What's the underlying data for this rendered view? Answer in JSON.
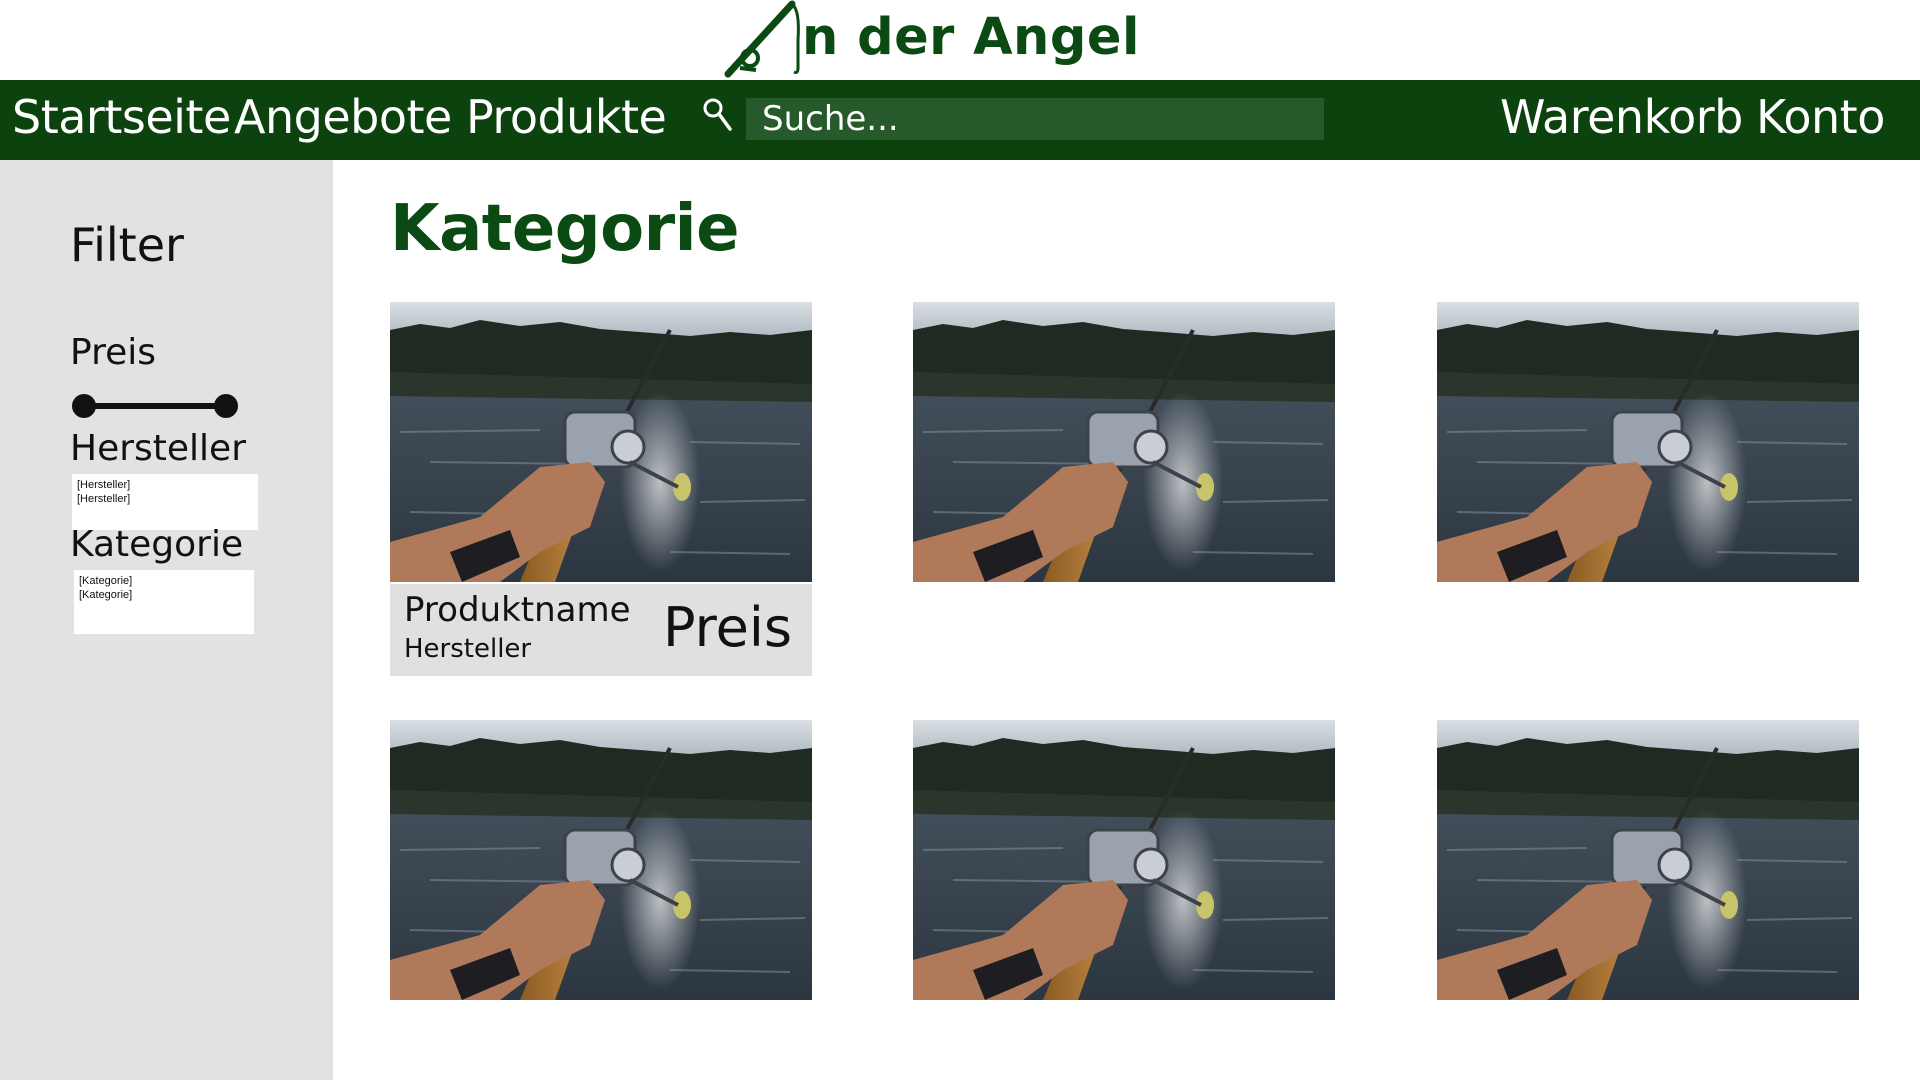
{
  "logo": {
    "text": "n der Angel",
    "icon": "fishing-rod-logo"
  },
  "nav": {
    "left_items": [
      "Startseite",
      "Angebote",
      "Produkte"
    ],
    "search_placeholder": "Suche...",
    "right_items": [
      "Warenkorb",
      "Konto"
    ]
  },
  "sidebar": {
    "title": "Filter",
    "price_label": "Preis",
    "manufacturer_label": "Hersteller",
    "manufacturer_options": [
      "[Hersteller]",
      "[Hersteller]"
    ],
    "category_label": "Kategorie",
    "category_options": [
      "[Kategorie]",
      "[Kategorie]"
    ]
  },
  "main": {
    "title": "Kategorie",
    "products": [
      {
        "name": "Produktname",
        "manufacturer": "Hersteller",
        "price": "Preis",
        "image": "fishing-photo",
        "expanded": true
      },
      {
        "image": "fishing-photo"
      },
      {
        "image": "fishing-photo"
      },
      {
        "image": "fishing-photo"
      },
      {
        "image": "fishing-photo"
      },
      {
        "image": "fishing-photo"
      }
    ]
  },
  "colors": {
    "brand_green": "#0b420d",
    "search_bg": "#275a2a",
    "sidebar_bg": "#e2e2e2",
    "card_info_bg": "#e0e0e0"
  }
}
